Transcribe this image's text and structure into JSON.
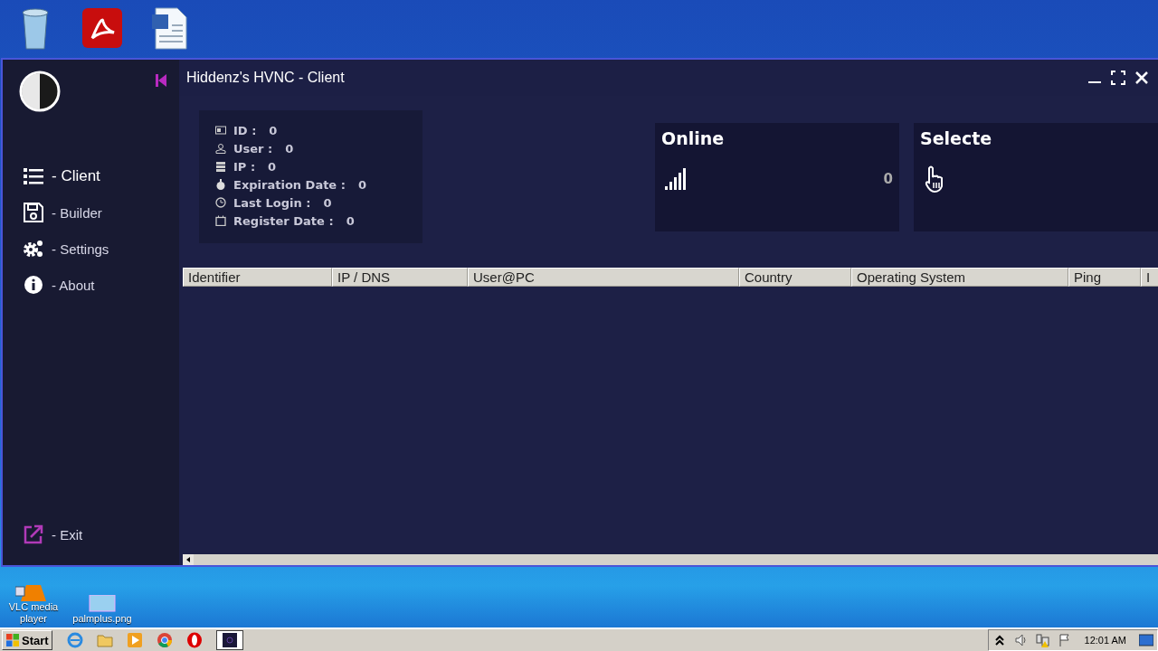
{
  "desktop_icons_top": [
    {
      "kind": "recycle"
    },
    {
      "kind": "pdf"
    },
    {
      "kind": "word"
    }
  ],
  "window": {
    "title": "Hiddenz's HVNC - Client"
  },
  "sidebar": {
    "items": [
      {
        "label": "- Client",
        "selected": true
      },
      {
        "label": "- Builder",
        "selected": false
      },
      {
        "label": "- Settings",
        "selected": false
      },
      {
        "label": "- About",
        "selected": false
      }
    ],
    "exit": {
      "label": "- Exit"
    }
  },
  "info": [
    {
      "label": "ID :",
      "value": "0"
    },
    {
      "label": "User :",
      "value": "0"
    },
    {
      "label": "IP :",
      "value": "0"
    },
    {
      "label": "Expiration Date :",
      "value": "0"
    },
    {
      "label": "Last Login :",
      "value": "0"
    },
    {
      "label": "Register Date :",
      "value": "0"
    }
  ],
  "cards": [
    {
      "kind": "signal",
      "title": "Online",
      "count": "0"
    },
    {
      "kind": "hand",
      "title": "Selecte"
    }
  ],
  "table": {
    "columns": [
      "Identifier",
      "IP / DNS",
      "User@PC",
      "Country",
      "Operating System",
      "Ping",
      "I"
    ]
  },
  "desktop_icons_bottom": [
    {
      "kind": "vlc",
      "label": "VLC media player"
    },
    {
      "kind": "image",
      "label": "palmplus.png"
    }
  ],
  "taskbar": {
    "start": "Start",
    "apps": [
      {
        "kind": "ie",
        "selected": false
      },
      {
        "kind": "folder",
        "selected": false
      },
      {
        "kind": "media",
        "selected": false
      },
      {
        "kind": "chrome",
        "selected": false
      },
      {
        "kind": "opera",
        "selected": false
      },
      {
        "kind": "app",
        "selected": true
      }
    ],
    "clock": "12:01 AM"
  }
}
